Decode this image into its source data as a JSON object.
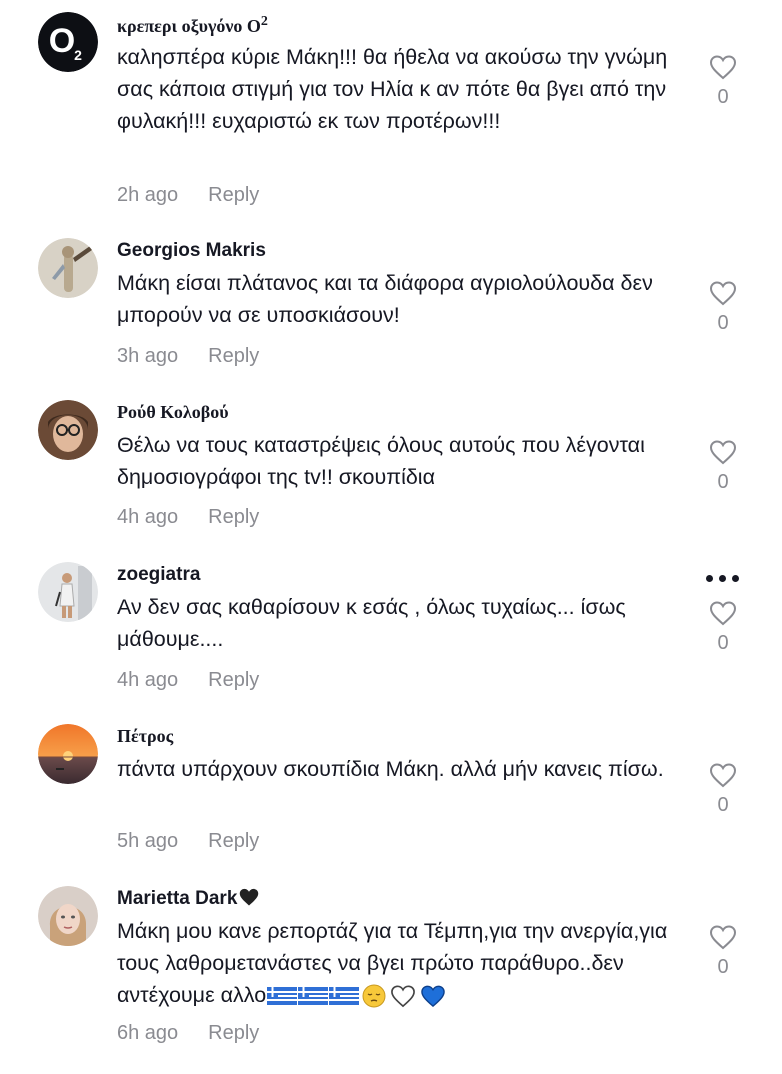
{
  "comments": [
    {
      "username": "κρεπερι οξυγόνο Ο",
      "username_sup": "2",
      "text": "καλησπέρα κύριε Μάκη!!! θα ήθελα να ακούσω την γνώμη σας κάποια στιγμή για τον Ηλία κ αν πότε θα βγει από την φυλακή!!! ευχαριστώ εκ των προτέρων!!!",
      "time": "2h ago",
      "reply": "Reply",
      "likes": "0",
      "avatar_icon": "o2-logo-avatar"
    },
    {
      "username": "Georgios Makris",
      "text": "Μάκη είσαι πλάτανος και τα διάφορα αγριολούλουδα δεν μπορούν να σε υποσκιάσουν!",
      "time": "3h ago",
      "reply": "Reply",
      "likes": "0",
      "avatar_icon": "statue-avatar"
    },
    {
      "username": "Ρούθ Κολοβού",
      "text": "Θέλω να τους καταστρέψεις όλους αυτούς που λέγονται δημοσιογράφοι της tv!! σκουπίδια",
      "time": "4h ago",
      "reply": "Reply",
      "likes": "0",
      "avatar_icon": "woman-glasses-avatar"
    },
    {
      "username": "zoegiatra",
      "text": "Αν δεν σας καθαρίσουν κ εσάς , όλως τυχαίως... ίσως μάθουμε....",
      "time": "4h ago",
      "reply": "Reply",
      "likes": "0",
      "avatar_icon": "woman-standing-avatar"
    },
    {
      "username": "Πέτρος",
      "text": "πάντα υπάρχουν σκουπίδια Μάκη. αλλά μήν κανεις πίσω.",
      "time": "5h ago",
      "reply": "Reply",
      "likes": "0",
      "avatar_icon": "sunset-avatar"
    },
    {
      "username": "Marietta Dark",
      "text_line1": "Μάκη μου κανε ρεπορτάζ για τα Τέμπη,για την ανεργία,για τους λαθρομετανάστες να βγει πρώτο",
      "text_line2": "παράθυρο..δεν αντέχουμε αλλο",
      "time": "6h ago",
      "reply": "Reply",
      "likes": "0",
      "avatar_icon": "woman-blonde-avatar"
    }
  ],
  "icons": {
    "like": "heart-outline-icon",
    "more": "more-options-icon",
    "black_heart": "black-heart-emoji",
    "greek_flag": "greek-flag-emoji",
    "pensive": "pensive-face-emoji",
    "white_heart": "white-heart-emoji",
    "blue_heart": "blue-heart-emoji"
  },
  "colors": {
    "text": "#161823",
    "meta": "#8a8b91",
    "flag_blue": "#2f6fd6",
    "blue_heart": "#1e6fd9"
  }
}
